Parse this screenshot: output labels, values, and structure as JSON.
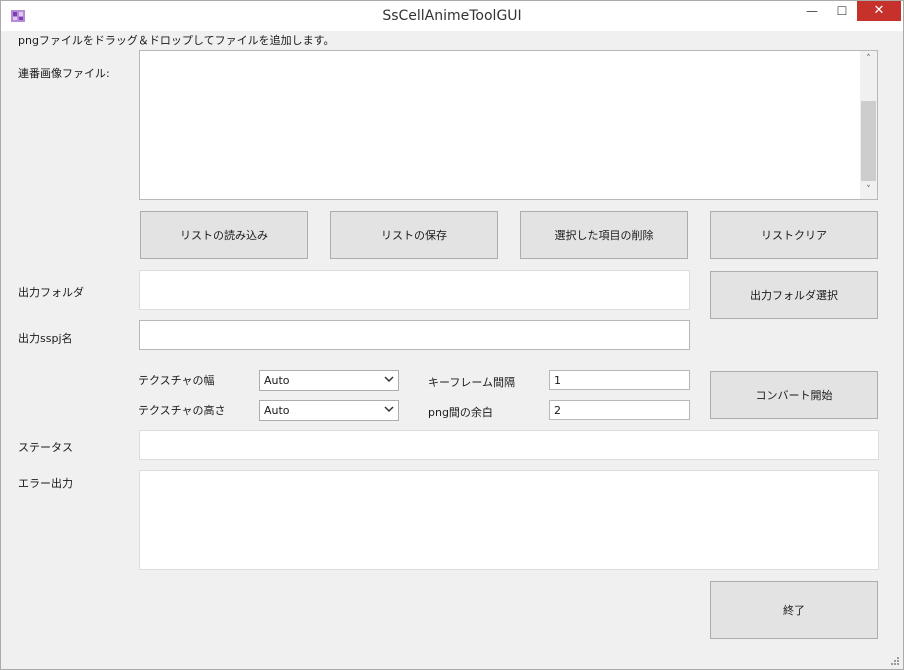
{
  "window": {
    "title": "SsCellAnimeToolGUI",
    "minimize_label": "—",
    "maximize_label": "☐",
    "close_label": "✕"
  },
  "instructions": "pngファイルをドラッグ＆ドロップしてファイルを追加します。",
  "file_list": {
    "label": "連番画像ファイル:",
    "scroll_up": "˄",
    "scroll_down": "˅"
  },
  "list_buttons": {
    "load": "リストの読み込み",
    "save": "リストの保存",
    "delete_selected": "選択した項目の削除",
    "clear": "リストクリア"
  },
  "output_folder": {
    "label": "出力フォルダ",
    "value": "",
    "select_button": "出力フォルダ選択"
  },
  "output_sspj": {
    "label": "出力sspj名",
    "value": ""
  },
  "texture": {
    "width_label": "テクスチャの幅",
    "width_value": "Auto",
    "height_label": "テクスチャの高さ",
    "height_value": "Auto"
  },
  "keyframe": {
    "interval_label": "キーフレーム間隔",
    "interval_value": "1",
    "margin_label": "png間の余白",
    "margin_value": "2"
  },
  "convert_button": "コンバート開始",
  "status": {
    "label": "ステータス",
    "value": ""
  },
  "error_output": {
    "label": "エラー出力",
    "value": ""
  },
  "exit_button": "終了"
}
